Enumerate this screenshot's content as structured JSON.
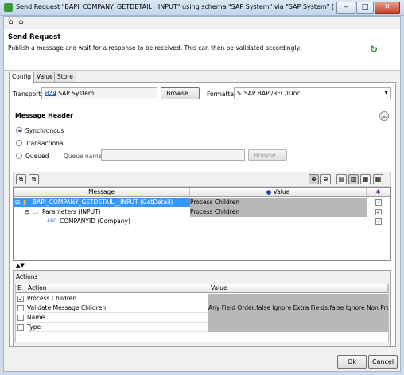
{
  "window": {
    "title": "Send Request \"BAPI_COMPANY_GETDETAIL__INPUT\"  using schema \"SAP System\" via \"SAP System\" [SAP Sys..."
  },
  "header": {
    "title": "Send Request",
    "description": "Publish a message and wait for a response to be received.  This can then be validated accordingly."
  },
  "tabs": [
    "Config",
    "Value",
    "Store"
  ],
  "transport": {
    "label": "Transport",
    "value": "SAP System",
    "browse": "Browse..."
  },
  "formatter": {
    "label": "Formatter",
    "value": "SAP BAPI/RFC/IDoc"
  },
  "message_header": {
    "title": "Message Header",
    "options": [
      "Synchronous",
      "Transactional",
      "Queued"
    ],
    "selected": "Synchronous",
    "queue_label": "Queue name",
    "queue_value": "",
    "browse": "Browse..."
  },
  "tree": {
    "columns": [
      "Message",
      "Value"
    ],
    "rows": [
      {
        "label": "BAPI_COMPANY_GETDETAIL__INPUT (GetDetail)",
        "value": "Process Children",
        "checked": true
      },
      {
        "label": "Parameters (INPUT)",
        "value": "Process Children",
        "checked": true
      },
      {
        "label": "COMPANYID (Company)",
        "value": "",
        "checked": true
      }
    ]
  },
  "actions": {
    "title": "Actions",
    "columns": [
      "E",
      "Action",
      "Value"
    ],
    "rows": [
      {
        "enabled": true,
        "action": "Process Children",
        "value": ""
      },
      {
        "enabled": false,
        "action": "Validate Message Children",
        "value": "Any Field Order:false Ignore Extra Fields:false Ignore Non Present"
      },
      {
        "enabled": false,
        "action": "Name",
        "value": ""
      },
      {
        "enabled": false,
        "action": "Type",
        "value": ""
      }
    ]
  },
  "buttons": {
    "ok": "Ok",
    "cancel": "Cancel"
  },
  "colors": {
    "selection": "#3399ff",
    "panel": "#f0f0f0",
    "titlebar": "#cfdbe9"
  }
}
